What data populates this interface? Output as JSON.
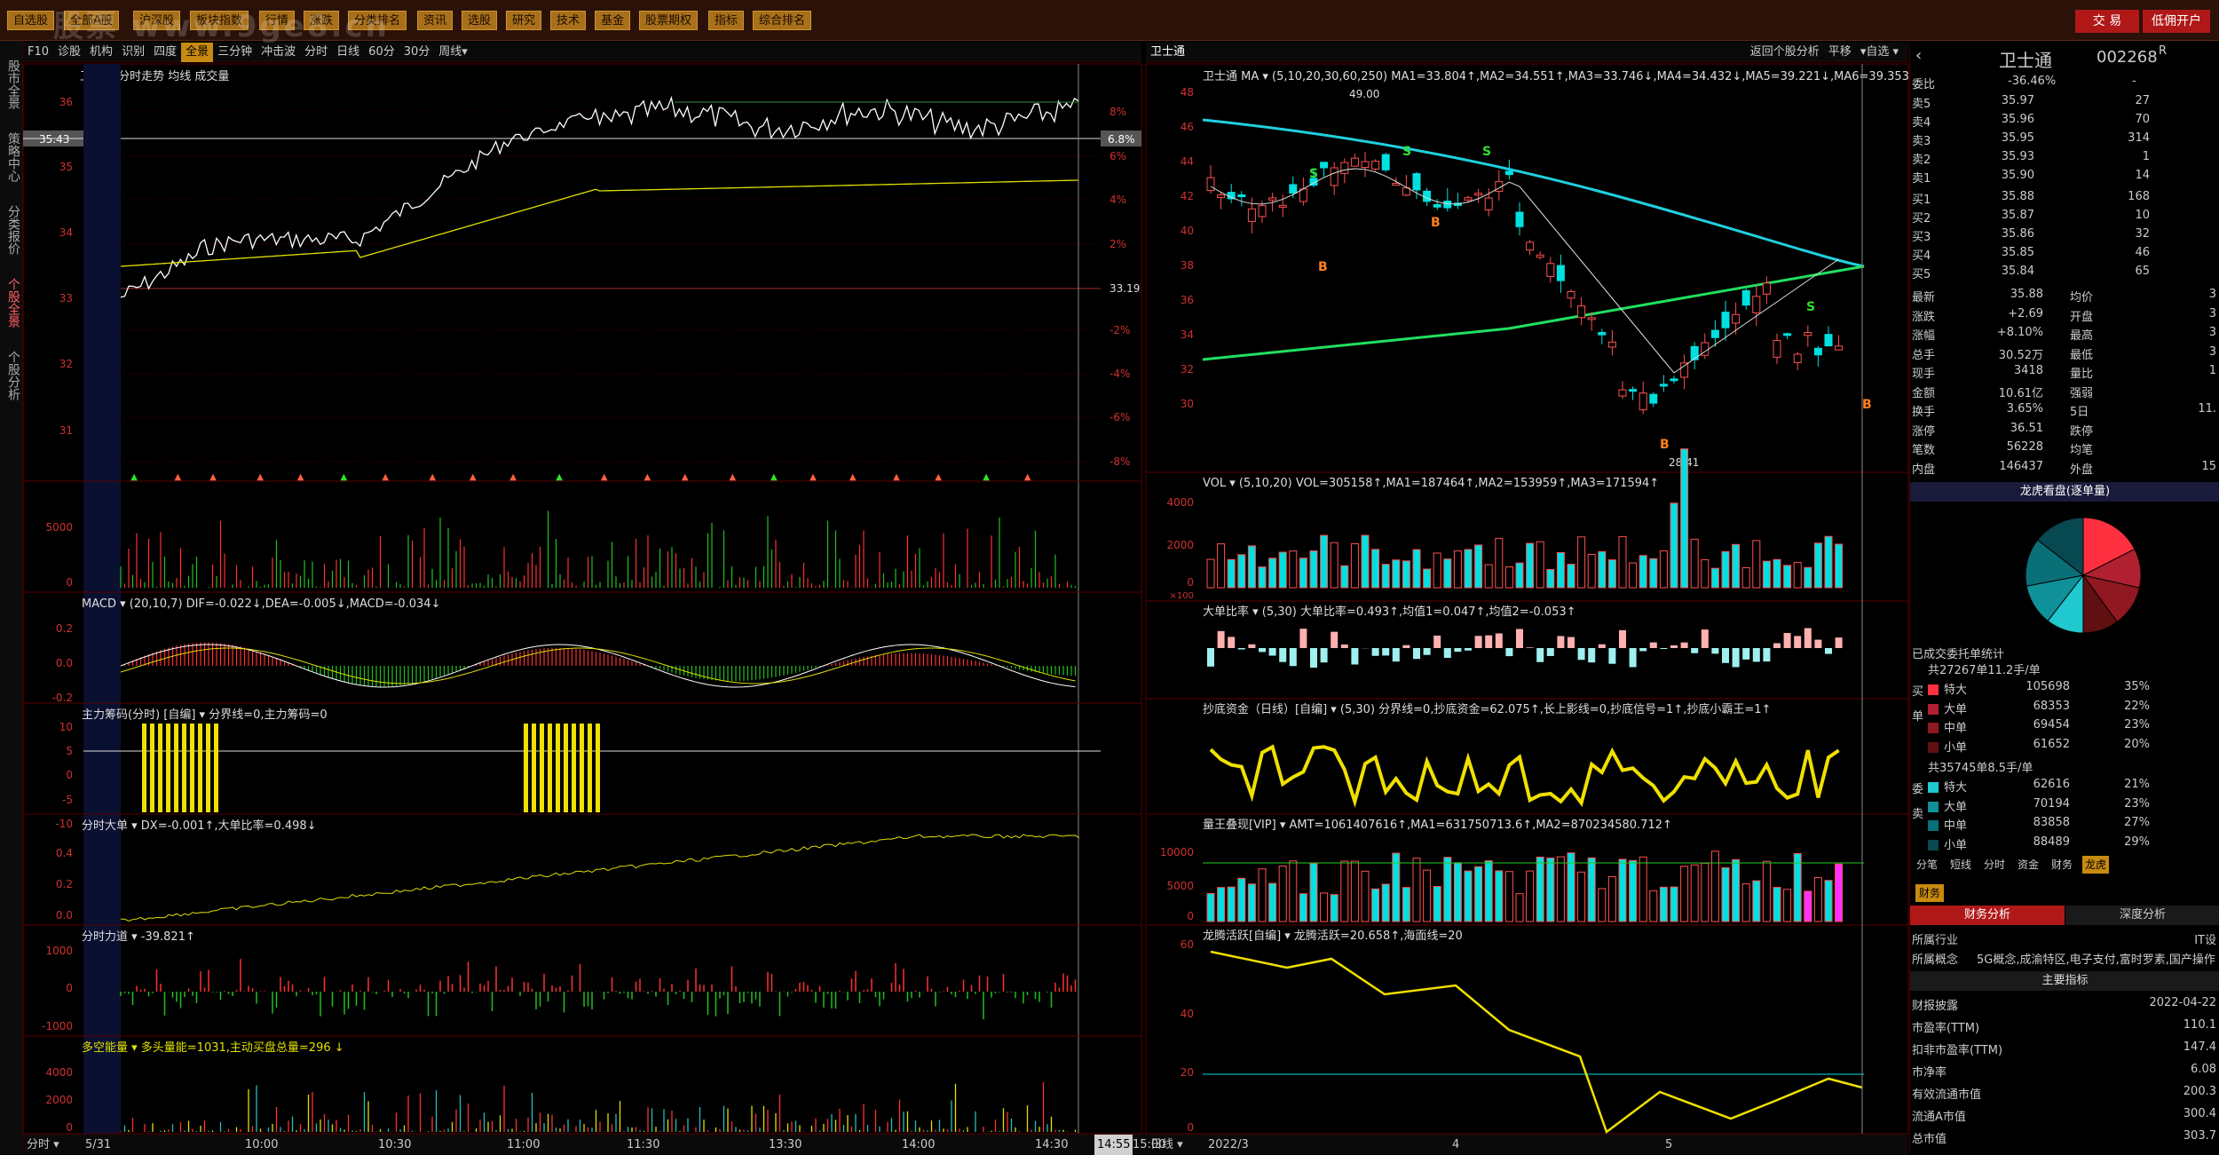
{
  "toolbar": {
    "menus": [
      "自选股",
      "全部A股",
      "沪深股",
      "板块指数",
      "行情",
      "涨跌",
      "分类排名",
      "资讯",
      "选股",
      "研究",
      "技术",
      "基金",
      "股票期权",
      "指标",
      "综合排名"
    ],
    "trade": "交 易",
    "lowcost": "低佣开户",
    "watermark": "股票 www.9ge8.cn"
  },
  "sidebar": {
    "items": [
      "股市全景",
      "策略中心",
      "分类报价",
      "个股全景",
      "个股分析"
    ]
  },
  "intraday": {
    "tabs": [
      "F10",
      "诊股",
      "机构",
      "识别",
      "四度",
      "全景",
      "三分钟",
      "冲击波",
      "分时",
      "日线",
      "60分",
      "30分",
      "周线▾"
    ],
    "active_tab": "全景",
    "title": "卫士通 分时走势 均线 成交量",
    "price_ticks": [
      "36",
      "35",
      "34",
      "33",
      "32",
      "31"
    ],
    "pct_ticks": [
      "8%",
      "6%",
      "4%",
      "2%",
      "-2%",
      "-4%",
      "-6%",
      "-8%"
    ],
    "price_label": "35.43",
    "pct_label": "6.8%",
    "prev_close": "33.19",
    "vol_ticks": [
      "5000",
      "0"
    ],
    "macd_title": "MACD ▾ (20,10,7) DIF=-0.022↓,DEA=-0.005↓,MACD=-0.034↓",
    "macd_ticks": [
      "0.2",
      "0.0",
      "-0.2"
    ],
    "main_force_title": "主力筹码(分时) [自编] ▾ 分界线=0,主力筹码=0",
    "mf_ticks": [
      "10",
      "5",
      "0",
      "-5",
      "-10"
    ],
    "big_title": "分时大单 ▾ DX=-0.001↑,大单比率=0.498↓",
    "big_ticks": [
      "0.4",
      "0.2",
      "0.0"
    ],
    "force_title": "分时力道 ▾ -39.821↑",
    "force_ticks": [
      "1000",
      "0",
      "-1000"
    ],
    "ls_title": "多空能量 ▾ 多头量能=1031,主动买盘总量=296 ↓",
    "ls_ticks": [
      "4000",
      "2000",
      "0"
    ],
    "time_labels": [
      "5/31",
      "10:00",
      "10:30",
      "11:00",
      "11:30",
      "13:30",
      "14:00",
      "14:30",
      "14:55",
      "15:00"
    ],
    "bottom_left": "分时 ▾"
  },
  "kline": {
    "title": "卫士通 MA ▾ (5,10,20,30,60,250) MA1=33.804↑,MA2=34.551↑,MA3=33.746↓,MA4=34.432↓,MA5=39.221↓,MA6=39.353↑",
    "right_buttons": [
      "返回个股分析",
      "平移",
      "▾自选 ▾"
    ],
    "price_ticks": [
      "48",
      "46",
      "44",
      "42",
      "40",
      "38",
      "36",
      "34",
      "32",
      "30"
    ],
    "high_label": "49.00",
    "low_label": "28.41",
    "vol_title": "VOL ▾ (5,10,20) VOL=305158↑,MA1=187464↑,MA2=153959↑,MA3=171594↑",
    "vol_ticks": [
      "4000",
      "2000",
      "0"
    ],
    "vol_unit": "×100",
    "big_ratio_title": "大单比率 ▾ (5,30) 大单比率=0.493↑,均值1=0.047↑,均值2=-0.053↑",
    "bottom_title": "抄底资金（日线）[自编] ▾ (5,30) 分界线=0,抄底资金=62.075↑,长上影线=0,抄底信号=1↑,抄底小霸王=1↑",
    "amount_title": "量王叠现[VIP] ▾ AMT=1061407616↑,MA1=631750713.6↑,MA2=870234580.712↑",
    "amt_ticks": [
      "10000",
      "5000",
      "0"
    ],
    "dragon_title": "龙腾活跃[自编] ▾ 龙腾活跃=20.658↑,海面线=20",
    "dragon_ticks": [
      "60",
      "40",
      "20",
      "0"
    ],
    "date_labels": [
      "2022/3",
      "4",
      "5"
    ],
    "bottom_left": "日线 ▾"
  },
  "quote": {
    "name": "卫士通",
    "code": "002268",
    "badge": "R",
    "webi_label": "委比",
    "webi": "-36.46%",
    "webi_diff": "-",
    "sell": [
      [
        "卖5",
        "35.97",
        "27"
      ],
      [
        "卖4",
        "35.96",
        "70"
      ],
      [
        "卖3",
        "35.95",
        "314"
      ],
      [
        "卖2",
        "35.93",
        "1"
      ],
      [
        "卖1",
        "35.90",
        "14"
      ]
    ],
    "buy": [
      [
        "买1",
        "35.88",
        "168"
      ],
      [
        "买2",
        "35.87",
        "10"
      ],
      [
        "买3",
        "35.86",
        "32"
      ],
      [
        "买4",
        "35.85",
        "46"
      ],
      [
        "买5",
        "35.84",
        "65"
      ]
    ],
    "stats": [
      [
        "最新",
        "35.88",
        "均价",
        "3"
      ],
      [
        "涨跌",
        "+2.69",
        "开盘",
        "3"
      ],
      [
        "涨幅",
        "+8.10%",
        "最高",
        "3"
      ],
      [
        "总手",
        "30.52万",
        "最低",
        "3"
      ],
      [
        "现手",
        "3418",
        "量比",
        "1"
      ],
      [
        "金额",
        "10.61亿",
        "强弱",
        ""
      ],
      [
        "换手",
        "3.65%",
        "5日",
        "11."
      ],
      [
        "涨停",
        "36.51",
        "跌停",
        ""
      ],
      [
        "笔数",
        "56228",
        "均笔",
        ""
      ],
      [
        "内盘",
        "146437",
        "外盘",
        "15"
      ]
    ],
    "dragon_header": "龙虎看盘(逐单量)",
    "orders_title": "已成交委托单统计",
    "buy_head": "共27267单11.2手/单",
    "buy_side": "买单",
    "buy_rows": [
      [
        "特大",
        "105698",
        "35%"
      ],
      [
        "大单",
        "68353",
        "22%"
      ],
      [
        "中单",
        "69454",
        "23%"
      ],
      [
        "小单",
        "61652",
        "20%"
      ]
    ],
    "sell_head": "共35745单8.5手/单",
    "sell_side": "委卖",
    "sell_rows": [
      [
        "特大",
        "62616",
        "21%"
      ],
      [
        "大单",
        "70194",
        "23%"
      ],
      [
        "中单",
        "83858",
        "27%"
      ],
      [
        "小单",
        "88489",
        "29%"
      ]
    ],
    "pie_slices": [
      35,
      22,
      23,
      20,
      21,
      23,
      27,
      29
    ],
    "tabs": [
      "分笔",
      "短线",
      "分时",
      "资金",
      "财务",
      "龙虎"
    ],
    "finance_tag": "财务",
    "fin_tabs": [
      "财务分析",
      "深度分析"
    ],
    "industry_label": "所属行业",
    "industry": "IT设",
    "concept_label": "所属概念",
    "concept": "5G概念,成渝特区,电子支付,富时罗素,国产操作",
    "main_idx": "主要指标",
    "fin_rows": [
      [
        "财报披露",
        "2022-04-22"
      ],
      [
        "市盈率(TTM)",
        "110.1"
      ],
      [
        "扣非市盈率(TTM)",
        "147.4"
      ],
      [
        "市净率",
        "6.08"
      ],
      [
        "有效流通市值",
        "200.3"
      ],
      [
        "流通A市值",
        "300.4"
      ],
      [
        "总市值",
        "303.7"
      ]
    ]
  }
}
